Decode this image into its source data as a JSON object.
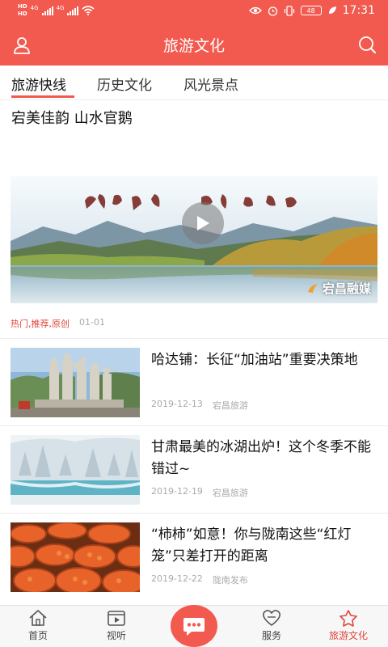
{
  "status_bar": {
    "sim_labels": [
      "HD",
      "HD"
    ],
    "network_labels": [
      "4G",
      "4G"
    ],
    "battery": "48",
    "time": "17:31"
  },
  "app_bar": {
    "title": "旅游文化",
    "left_icon": "user-icon",
    "right_icon": "search-icon"
  },
  "tabs": [
    {
      "label": "旅游快线",
      "active": true
    },
    {
      "label": "历史文化",
      "active": false
    },
    {
      "label": "风光景点",
      "active": false
    }
  ],
  "feature": {
    "title": "宕美佳韵 山水官鹅",
    "image_caption": "宕美佳韵 山水官鹅",
    "watermark": "宕昌融媒",
    "tags": "热门,推荐,原创",
    "date": "01-01"
  },
  "news": [
    {
      "title": "哈达铺：长征“加油站”重要决策地",
      "date": "2019-12-13",
      "source": "宕昌旅游"
    },
    {
      "title": "甘肃最美的冰湖出炉！这个冬季不能错过~",
      "date": "2019-12-19",
      "source": "宕昌旅游"
    },
    {
      "title": "“柿柿”如意！你与陇南这些“红灯笼”只差打开的距离",
      "date": "2019-12-22",
      "source": "陇南发布"
    }
  ],
  "bottom_nav": {
    "items": [
      {
        "label": "首页",
        "icon": "home-icon",
        "active": false
      },
      {
        "label": "视听",
        "icon": "video-icon",
        "active": false
      },
      {
        "label": "服务",
        "icon": "heart-icon",
        "active": false
      },
      {
        "label": "旅游文化",
        "icon": "tourism-icon",
        "active": true
      }
    ],
    "center_icon": "chat-icon"
  },
  "colors": {
    "accent": "#f25a50",
    "tag_red": "#e0463e",
    "meta_gray": "#aaaaaa"
  }
}
